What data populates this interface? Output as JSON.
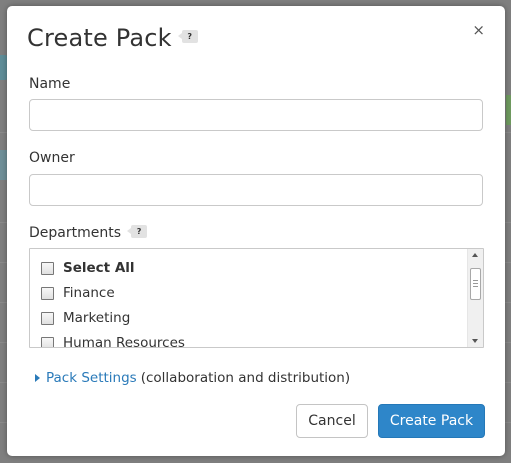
{
  "dialog": {
    "title": "Create Pack",
    "title_help": "?",
    "close_symbol": "×",
    "close_icon": "close-icon"
  },
  "form": {
    "name_label": "Name",
    "name_value": "",
    "owner_label": "Owner",
    "owner_value": "",
    "departments_label": "Departments",
    "departments_help": "?",
    "departments": [
      {
        "label": "Select All",
        "checked": false,
        "bold": true
      },
      {
        "label": "Finance",
        "checked": false
      },
      {
        "label": "Marketing",
        "checked": false
      },
      {
        "label": "Human Resources",
        "checked": false
      }
    ]
  },
  "settings": {
    "link_label": "Pack Settings",
    "description": "(collaboration and distribution)",
    "caret_icon": "caret-right-icon"
  },
  "footer": {
    "cancel_label": "Cancel",
    "create_label": "Create Pack"
  },
  "colors": {
    "primary": "#2e86c9",
    "link": "#2a7ab9",
    "overlay": "#7f7f7f"
  }
}
